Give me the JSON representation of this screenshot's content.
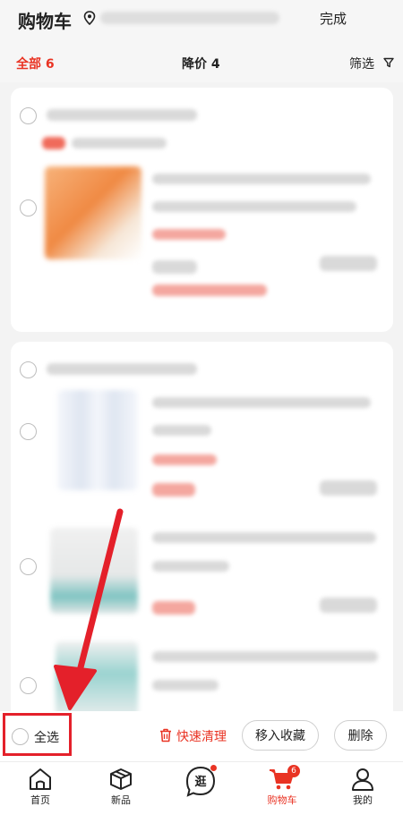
{
  "header": {
    "title": "购物车",
    "done_label": "完成"
  },
  "filter_tabs": {
    "all_label": "全部",
    "all_count": "6",
    "price_drop_label": "降价",
    "price_drop_count": "4",
    "filter_label": "筛选"
  },
  "bottom_bar": {
    "select_all_label": "全选",
    "quick_clean_label": "快速清理",
    "move_to_favorites_label": "移入收藏",
    "delete_label": "删除"
  },
  "tab_bar": {
    "items": [
      {
        "label": "首页",
        "icon": "home-icon"
      },
      {
        "label": "新品",
        "icon": "box-icon"
      },
      {
        "label": "逛",
        "icon": "browse-icon"
      },
      {
        "label": "购物车",
        "icon": "cart-icon",
        "badge": "6"
      },
      {
        "label": "我的",
        "icon": "user-icon"
      }
    ]
  },
  "colors": {
    "accent": "#e93323",
    "annotation": "#e4202a"
  }
}
